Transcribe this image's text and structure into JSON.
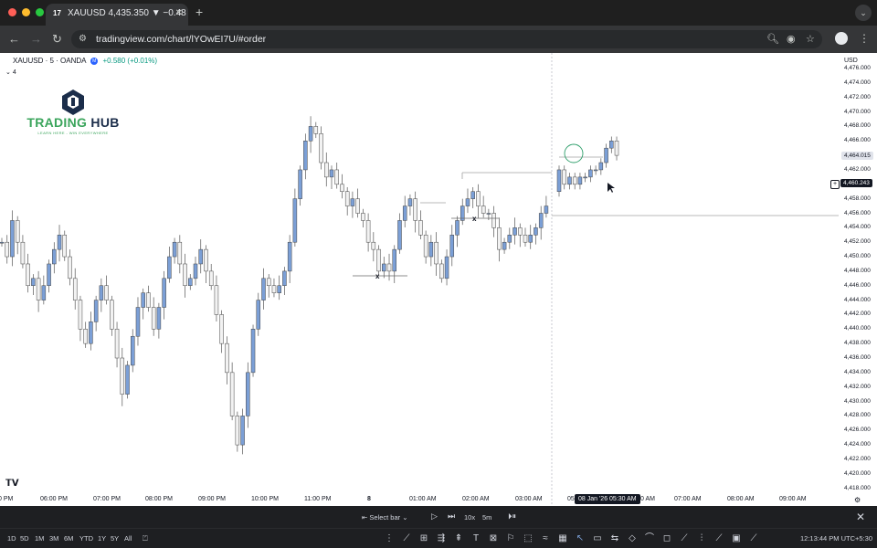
{
  "browser": {
    "tab_title": "XAUUSD 4,435.350 ▼ −0.48",
    "tab_favicon": "17",
    "url": "tradingview.com/chart/lYOwEI7U/#order",
    "colors": {
      "tab_bar": "#1f1f1f",
      "toolbar": "#353638",
      "omnibox": "#282a2c"
    }
  },
  "chart": {
    "symbol": "XAUUSD · 5 · OANDA",
    "change": "+0.580 (+0.01%)",
    "indicator_count": "4",
    "currency": "USD",
    "price_axis": [
      "4,476.000",
      "4,474.000",
      "4,472.000",
      "4,470.000",
      "4,468.000",
      "4,466.000",
      "4,464.015",
      "4,462.000",
      "4,460.243",
      "4,458.000",
      "4,456.000",
      "4,454.000",
      "4,452.000",
      "4,450.000",
      "4,448.000",
      "4,446.000",
      "4,444.000",
      "4,442.000",
      "4,440.000",
      "4,438.000",
      "4,436.000",
      "4,434.000",
      "4,432.000",
      "4,430.000",
      "4,428.000",
      "4,426.000",
      "4,424.000",
      "4,422.000",
      "4,420.000",
      "4,418.000"
    ],
    "last_price_tag": "4,464.015",
    "crosshair_price_tag": "4,460.243",
    "time_axis": [
      "0 PM",
      "06:00 PM",
      "07:00 PM",
      "08:00 PM",
      "09:00 PM",
      "10:00 PM",
      "11:00 PM",
      "8",
      "01:00 AM",
      "02:00 AM",
      "03:00 AM",
      "07:00 AM",
      "08:00 AM",
      "09:00 AM"
    ],
    "crosshair_time_tag": "08 Jan '26   05:30 AM",
    "crosshair_time_left": "05:",
    "crosshair_time_right": "0 AM",
    "marker_x_label": "x",
    "colors": {
      "up": "#7b9fd6",
      "down": "#f2f2f2",
      "wick": "#555555",
      "line": "#a0a0a0"
    }
  },
  "logo": {
    "name_part1": "TRADING",
    "name_part2": "HUB",
    "tagline": "LEARN HERE - WIN EVERYWHERE"
  },
  "replay": {
    "select_bar": "Select bar",
    "speed": "10x",
    "interval": "5m"
  },
  "footer": {
    "ranges": [
      "1D",
      "5D",
      "1M",
      "3M",
      "6M",
      "YTD",
      "1Y",
      "5Y",
      "All"
    ],
    "clock": "12:13:44 PM UTC+5:30"
  },
  "icons": [
    "back-icon",
    "forward-icon",
    "reload-icon",
    "site-settings-icon",
    "zoom-icon",
    "eye-icon",
    "star-icon",
    "profile-icon",
    "menu-icon",
    "play-icon",
    "step-forward-icon",
    "fast-forward-icon",
    "close-icon",
    "tradingview-logo"
  ]
}
